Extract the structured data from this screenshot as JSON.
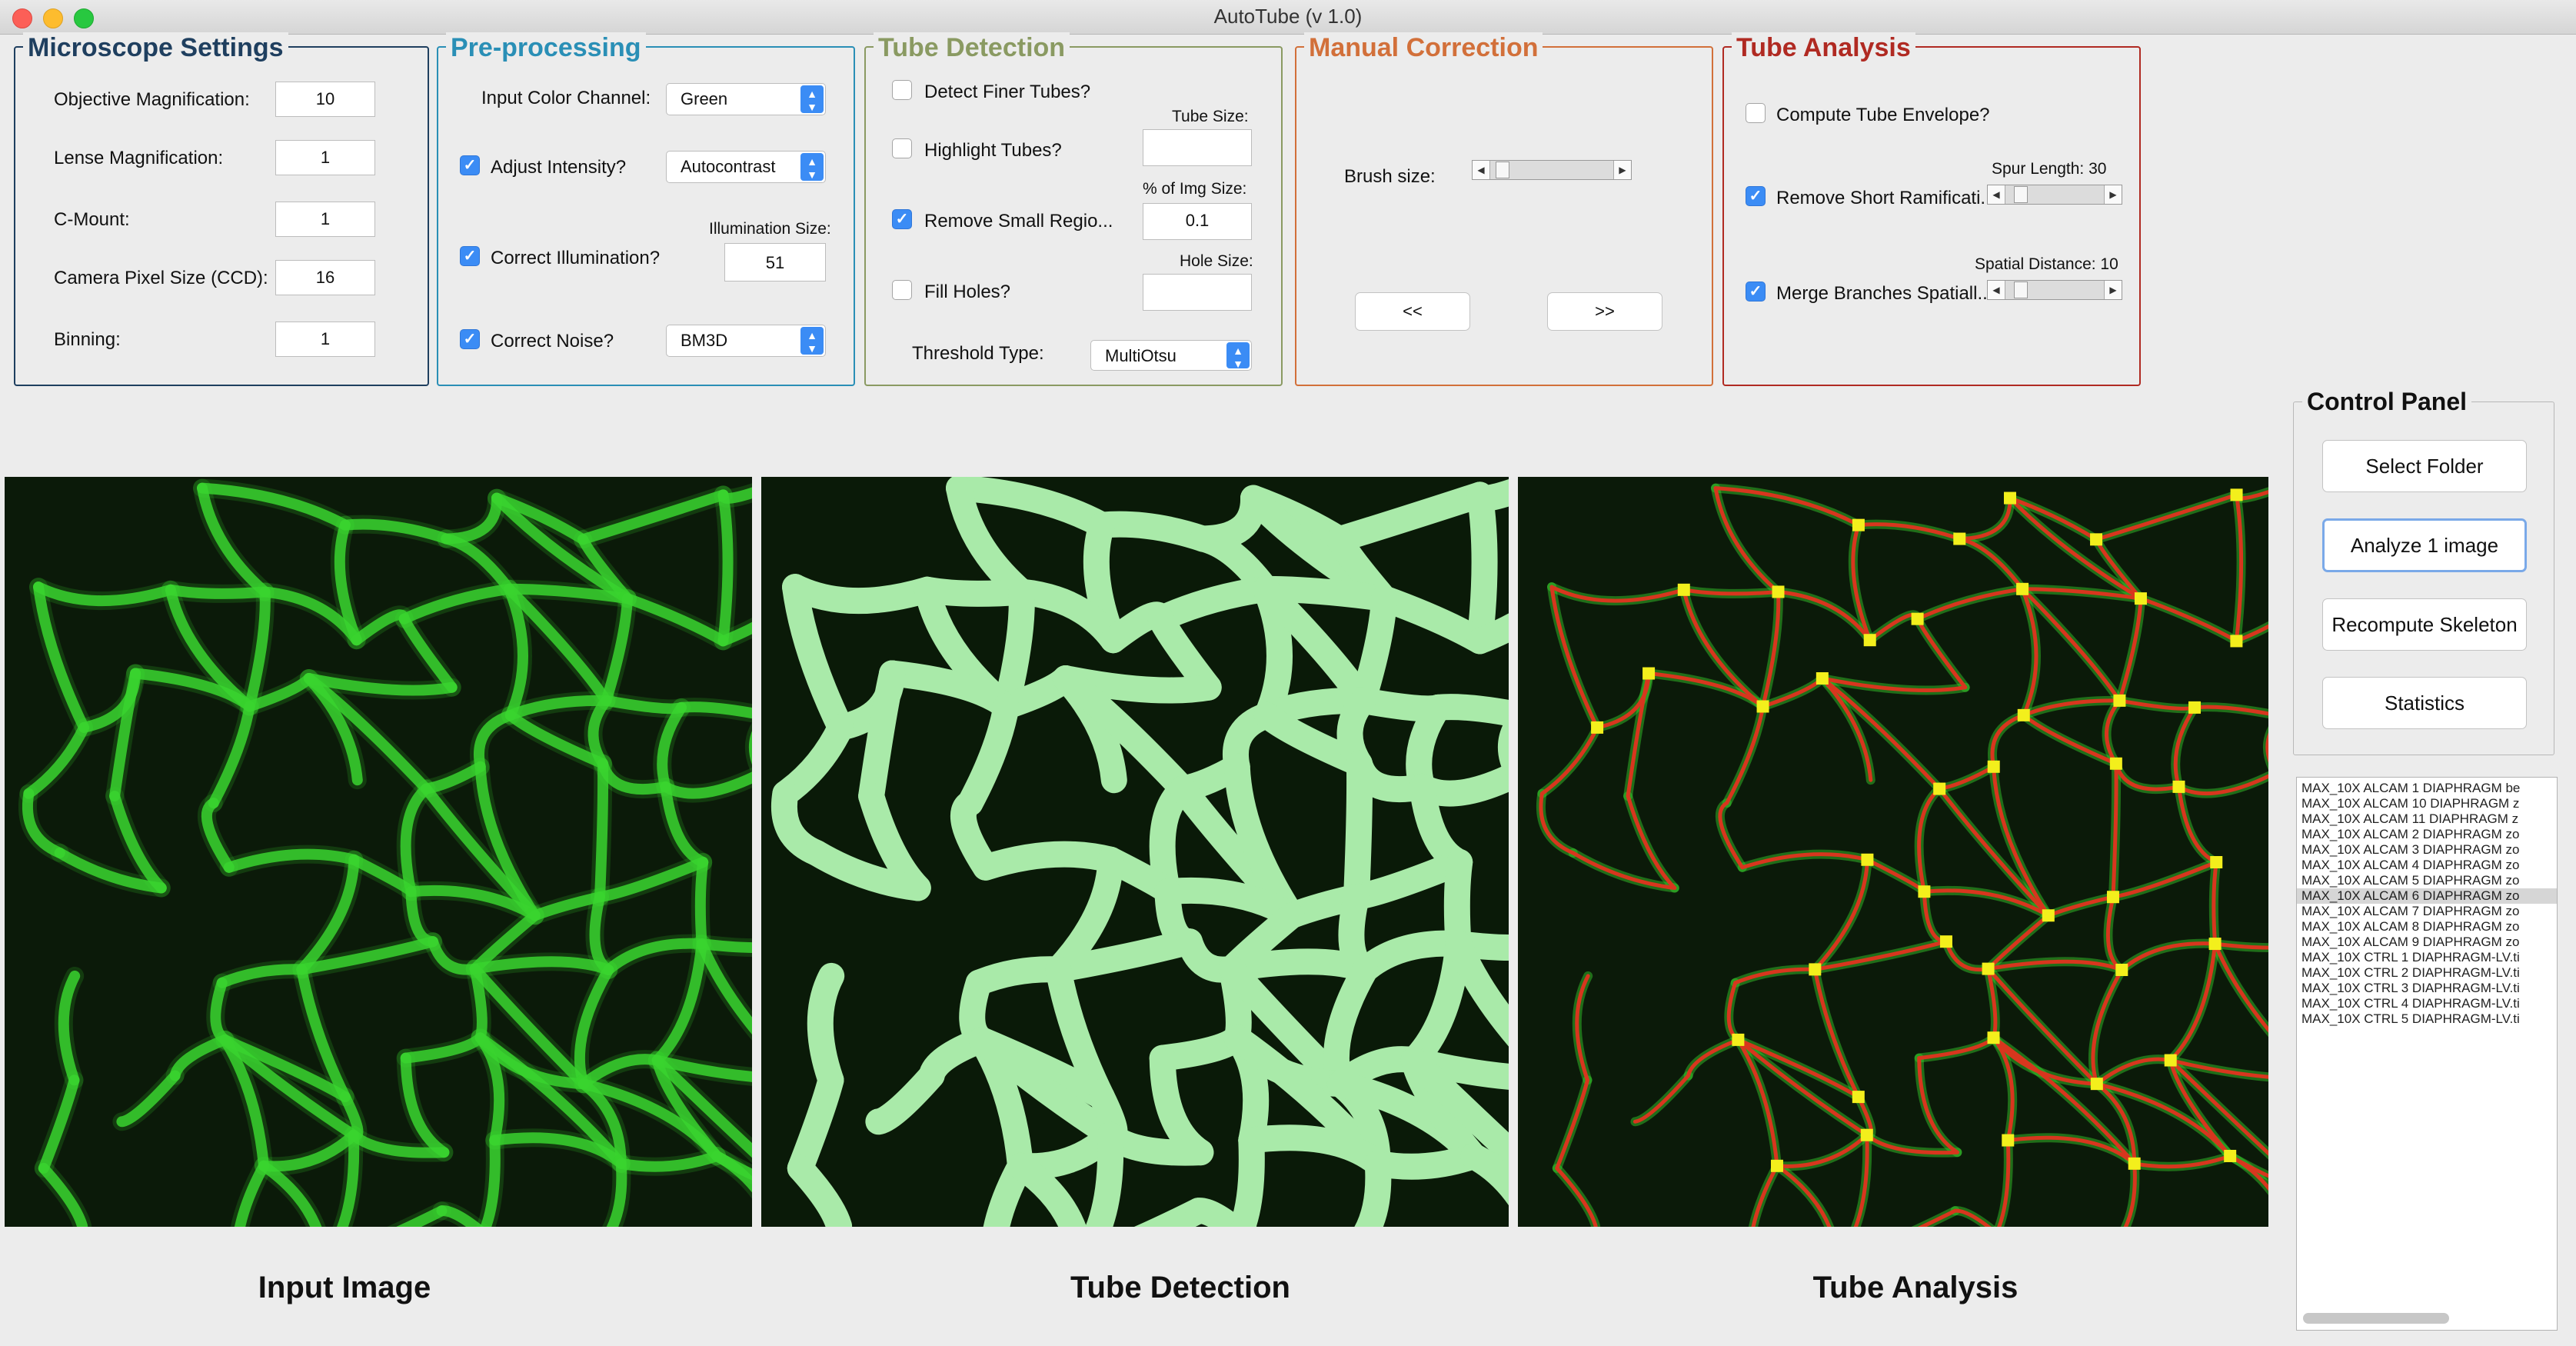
{
  "window": {
    "title": "AutoTube (v 1.0)"
  },
  "microscope": {
    "title": "Microscope Settings",
    "objective_label": "Objective Magnification:",
    "objective_value": "10",
    "lense_label": "Lense Magnification:",
    "lense_value": "1",
    "cmount_label": "C-Mount:",
    "cmount_value": "1",
    "pixel_label": "Camera Pixel Size (CCD):",
    "pixel_value": "16",
    "binning_label": "Binning:",
    "binning_value": "1"
  },
  "preprocessing": {
    "title": "Pre-processing",
    "channel_label": "Input Color Channel:",
    "channel_value": "Green",
    "intensity_label": "Adjust Intensity?",
    "intensity_checked": true,
    "intensity_value": "Autocontrast",
    "illum_size_label": "Illumination Size:",
    "illum_label": "Correct Illumination?",
    "illum_checked": true,
    "illum_value": "51",
    "noise_label": "Correct Noise?",
    "noise_checked": true,
    "noise_value": "BM3D"
  },
  "detection": {
    "title": "Tube Detection",
    "finer_label": "Detect Finer Tubes?",
    "finer_checked": false,
    "tube_size_label": "Tube Size:",
    "tube_size_value": "",
    "highlight_label": "Highlight Tubes?",
    "highlight_checked": false,
    "img_size_label": "% of Img Size:",
    "remove_label": "Remove Small Regio...",
    "remove_checked": true,
    "remove_value": "0.1",
    "hole_size_label": "Hole Size:",
    "fill_label": "Fill Holes?",
    "fill_checked": false,
    "fill_value": "",
    "threshold_label": "Threshold Type:",
    "threshold_value": "MultiOtsu"
  },
  "manual": {
    "title": "Manual Correction",
    "brush_label": "Brush size:",
    "prev_label": "<<",
    "next_label": ">>"
  },
  "analysis": {
    "title": "Tube Analysis",
    "envelope_label": "Compute Tube Envelope?",
    "envelope_checked": false,
    "spur_label": "Spur Length: 30",
    "remove_label": "Remove Short Ramificati...",
    "remove_checked": true,
    "spatial_label": "Spatial Distance: 10",
    "merge_label": "Merge Branches Spatiall...",
    "merge_checked": true
  },
  "control": {
    "title": "Control Panel",
    "select_folder": "Select Folder",
    "analyze": "Analyze 1 image",
    "recompute": "Recompute Skeleton",
    "statistics": "Statistics"
  },
  "files": [
    "MAX_10X ALCAM 1 DIAPHRAGM be",
    "MAX_10X ALCAM 10 DIAPHRAGM z",
    "MAX_10X ALCAM 11 DIAPHRAGM z",
    "MAX_10X ALCAM 2 DIAPHRAGM zo",
    "MAX_10X ALCAM 3 DIAPHRAGM zo",
    "MAX_10X ALCAM 4 DIAPHRAGM zo",
    "MAX_10X ALCAM 5 DIAPHRAGM zo",
    "MAX_10X ALCAM 6 DIAPHRAGM zo",
    "MAX_10X ALCAM 7 DIAPHRAGM zo",
    "MAX_10X ALCAM 8 DIAPHRAGM zo",
    "MAX_10X ALCAM 9 DIAPHRAGM zo",
    "MAX_10X CTRL 1 DIAPHRAGM-LV.ti",
    "MAX_10X CTRL 2 DIAPHRAGM-LV.ti",
    "MAX_10X CTRL 3 DIAPHRAGM-LV.ti",
    "MAX_10X CTRL 4 DIAPHRAGM-LV.ti",
    "MAX_10X CTRL 5 DIAPHRAGM-LV.ti"
  ],
  "files_selected_index": 7,
  "captions": {
    "input": "Input Image",
    "detection": "Tube Detection",
    "analysis": "Tube Analysis"
  },
  "colors": {
    "microscope_title": "#1f3f5f",
    "preprocessing_title": "#2a8fb6",
    "detection_title": "#8a9a62",
    "manual_title": "#d2703a",
    "analysis_title": "#b02a22",
    "vessel_green": "#39d42f",
    "mask_green": "#a9eaa9",
    "skeleton_red": "#d8361e",
    "node_yellow": "#f3ef1c"
  }
}
